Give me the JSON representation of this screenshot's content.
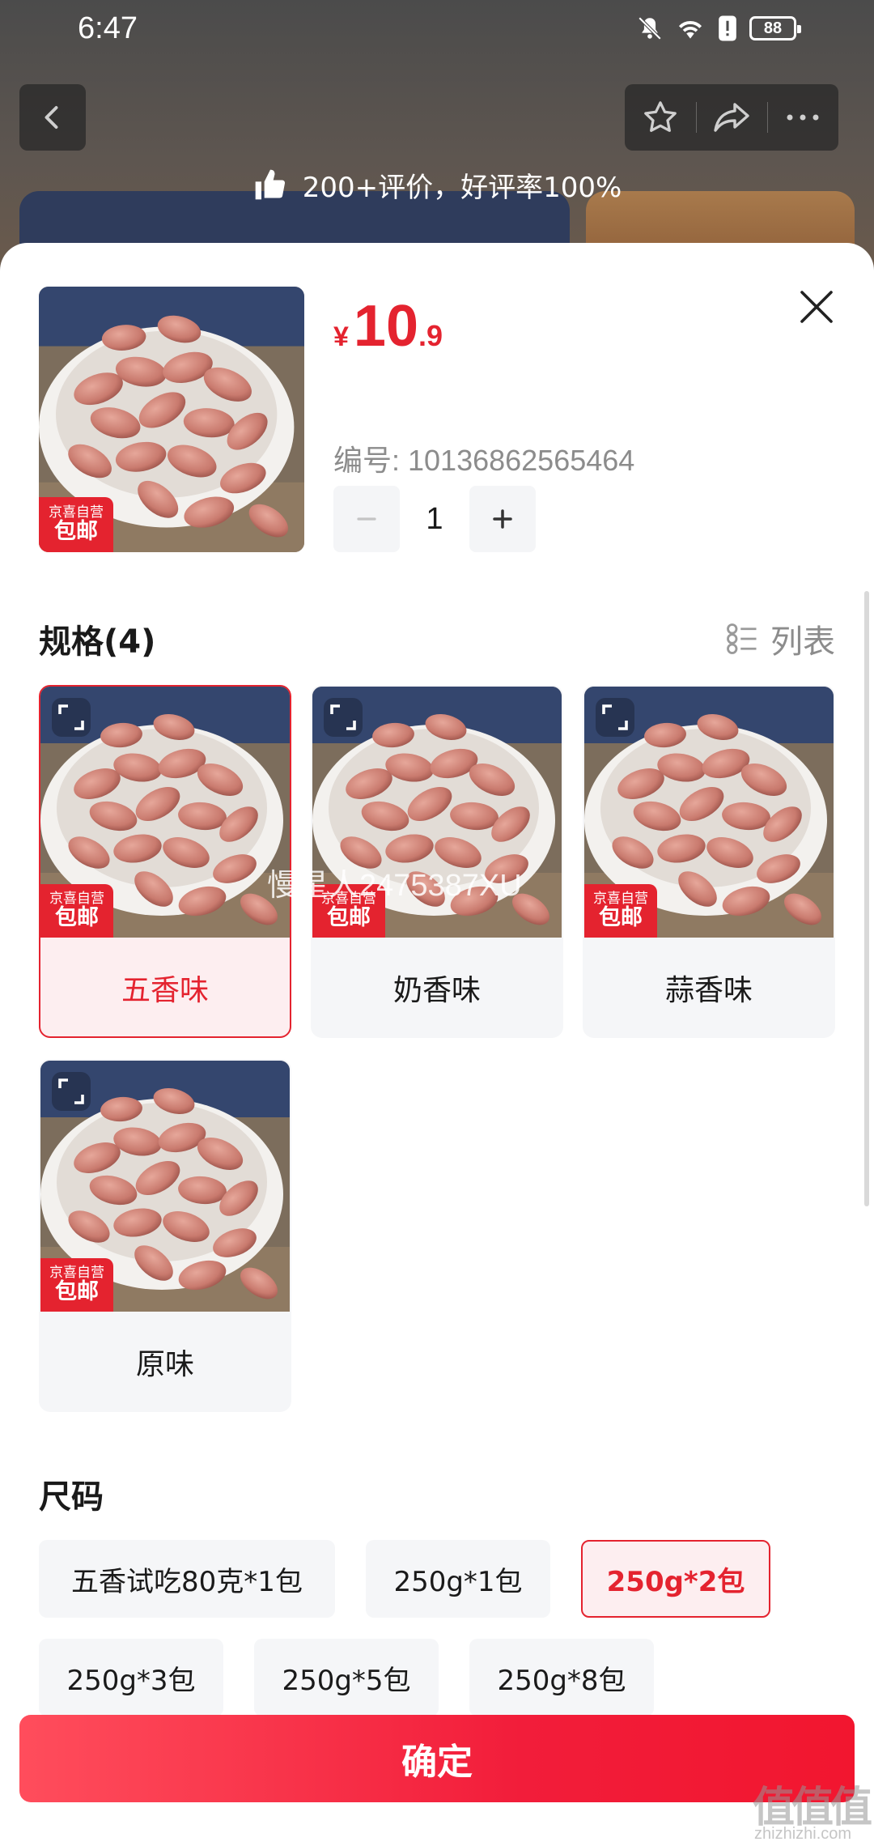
{
  "status_bar": {
    "time": "6:47",
    "battery": "88",
    "icons": [
      "bell-off-icon",
      "wifi-icon",
      "alert-icon",
      "battery-icon"
    ]
  },
  "nav": {
    "icons": [
      "back-icon",
      "star-icon",
      "share-icon",
      "more-icon"
    ]
  },
  "review_banner": {
    "text": "200+评价，好评率100%",
    "icon": "thumbs-up-icon"
  },
  "product": {
    "badge_top": "京喜自营",
    "badge_bottom": "包邮",
    "price_currency": "¥",
    "price_integer": "10",
    "price_decimal": ".9",
    "sku_code": "编号: 10136862565464",
    "quantity": "1"
  },
  "spec_section": {
    "title": "规格(4)",
    "view_toggle": "列表",
    "options": [
      {
        "label": "五香味",
        "selected": true
      },
      {
        "label": "奶香味",
        "selected": false
      },
      {
        "label": "蒜香味",
        "selected": false
      },
      {
        "label": "原味",
        "selected": false
      }
    ]
  },
  "watermark": "慢星人2475387XU",
  "size_section": {
    "title": "尺码",
    "options": [
      {
        "label": "五香试吃80克*1包",
        "selected": false
      },
      {
        "label": "250g*1包",
        "selected": false
      },
      {
        "label": "250g*2包",
        "selected": true
      },
      {
        "label": "250g*3包",
        "selected": false
      },
      {
        "label": "250g*5包",
        "selected": false
      },
      {
        "label": "250g*8包",
        "selected": false
      }
    ]
  },
  "confirm_button": "确定",
  "corner_logo": {
    "title": "值值值",
    "sub": "zhizhizhi.com"
  },
  "colors": {
    "accent": "#e4232f",
    "selected_bg": "#fdeef0",
    "chip_bg": "#f5f6f8"
  }
}
